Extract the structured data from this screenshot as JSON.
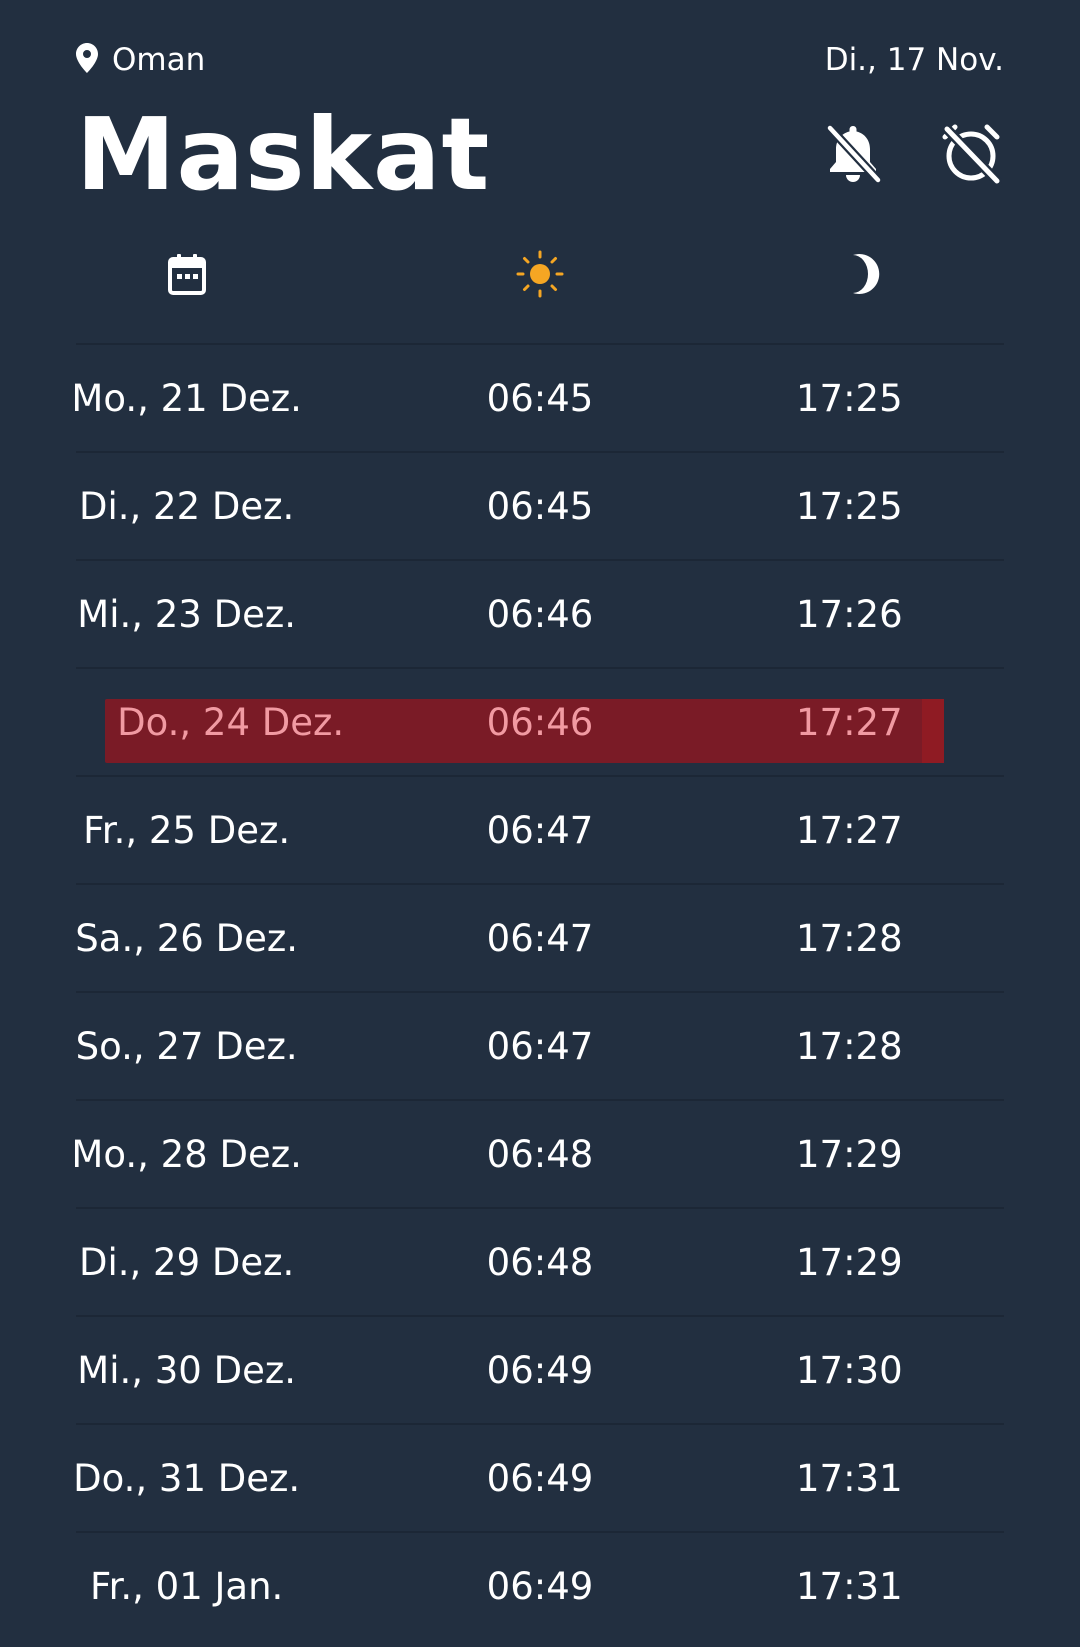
{
  "topbar": {
    "country": "Oman",
    "today_date": "Di., 17 Nov."
  },
  "header": {
    "city": "Maskat"
  },
  "icons": {
    "location": "map-pin-icon",
    "notifications": "bell-off-icon",
    "alarm": "alarm-off-icon",
    "date_column": "calendar-icon",
    "sunrise_column": "sun-icon",
    "sunset_column": "moon-icon"
  },
  "colors": {
    "background": "#222f40",
    "sun": "#f5a623",
    "highlight": "#7a1b26",
    "highlight_text": "#f19aa2"
  },
  "rows": [
    {
      "date": "Mo., 21 Dez.",
      "sunrise": "06:45",
      "sunset": "17:25"
    },
    {
      "date": "Di., 22 Dez.",
      "sunrise": "06:45",
      "sunset": "17:25"
    },
    {
      "date": "Mi., 23 Dez.",
      "sunrise": "06:46",
      "sunset": "17:26"
    },
    {
      "date": "Do., 24 Dez.",
      "sunrise": "06:46",
      "sunset": "17:27",
      "highlighted": true
    },
    {
      "date": "Fr., 25 Dez.",
      "sunrise": "06:47",
      "sunset": "17:27"
    },
    {
      "date": "Sa., 26 Dez.",
      "sunrise": "06:47",
      "sunset": "17:28"
    },
    {
      "date": "So., 27 Dez.",
      "sunrise": "06:47",
      "sunset": "17:28"
    },
    {
      "date": "Mo., 28 Dez.",
      "sunrise": "06:48",
      "sunset": "17:29"
    },
    {
      "date": "Di., 29 Dez.",
      "sunrise": "06:48",
      "sunset": "17:29"
    },
    {
      "date": "Mi., 30 Dez.",
      "sunrise": "06:49",
      "sunset": "17:30"
    },
    {
      "date": "Do., 31 Dez.",
      "sunrise": "06:49",
      "sunset": "17:31"
    },
    {
      "date": "Fr., 01 Jan.",
      "sunrise": "06:49",
      "sunset": "17:31"
    }
  ]
}
